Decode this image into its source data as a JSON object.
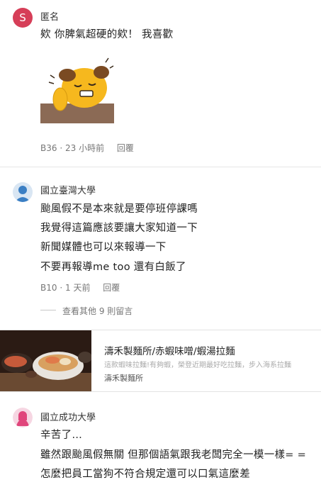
{
  "comments": [
    {
      "author": "匿名",
      "avatar_letter": "S",
      "avatar_color": "#d63e58",
      "lines": [
        "欸 你脾氣超硬的欸！ 我喜歡"
      ],
      "floor": "B36",
      "sep": "·",
      "time": "23 小時前",
      "reply": "回覆",
      "sticker": "yellow-dog-sticker"
    },
    {
      "author": "國立臺灣大學",
      "avatar_color": "#3b7fc4",
      "lines": [
        "颱風假不是本來就是要停班停課嗎",
        "我覺得這篇應該要讓大家知道一下",
        "新聞媒體也可以來報導一下",
        "不要再報導me too 還有白飯了"
      ],
      "floor": "B10",
      "sep": "·",
      "time": "1 天前",
      "reply": "回覆"
    },
    {
      "author": "國立成功大學",
      "avatar_color": "#e0457b",
      "lines": [
        "辛苦了…",
        "雖然跟颱風假無關 但那個語氣跟我老闆完全一模一樣= =",
        "怎麼把員工當狗不符合規定還可以口氣這麼差"
      ]
    }
  ],
  "more_replies": "查看其他 9 則留言",
  "ad": {
    "title": "濤禾製麵所/赤蝦味噌/蝦湯拉麵",
    "desc": "這款蝦味拉麵!有夠蝦，榮登近期最好吃拉麵，步入海系拉麵",
    "brand": "濤禾製麵所"
  },
  "colors": {
    "divider": "#e6e6e6",
    "meta": "#777777"
  }
}
